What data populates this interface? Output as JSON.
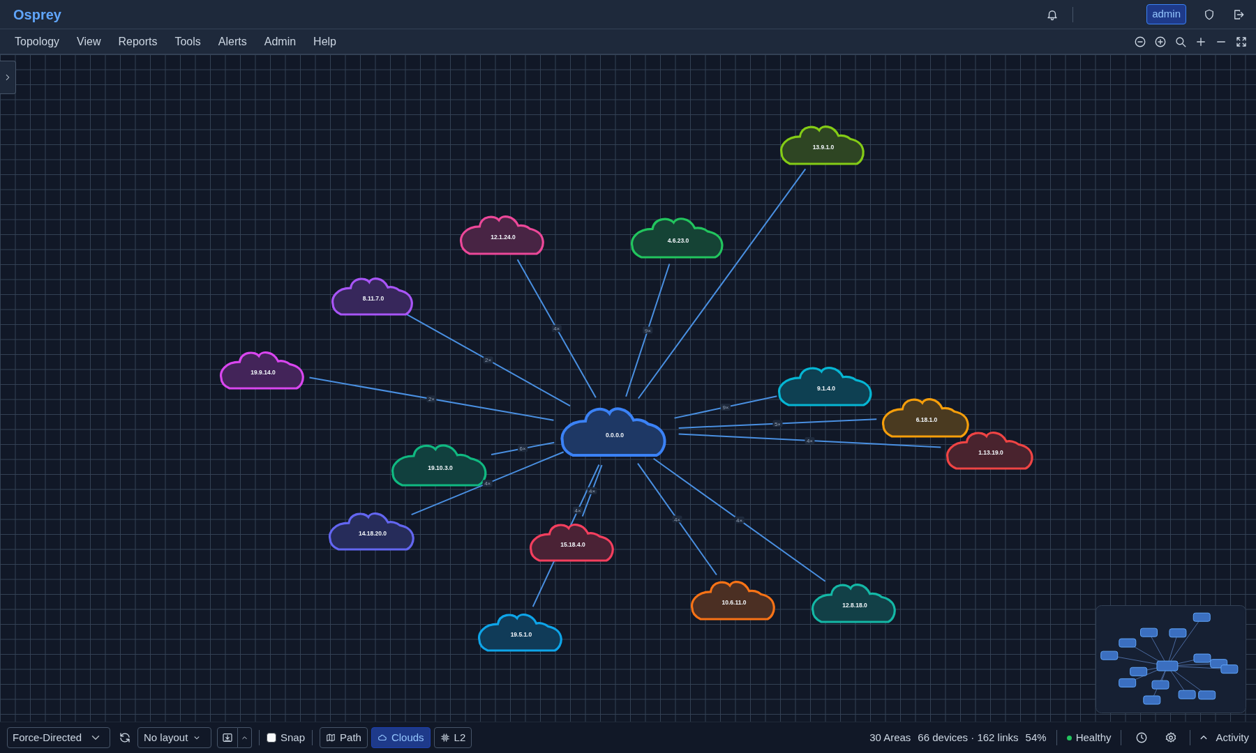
{
  "app": {
    "title": "Osprey"
  },
  "header": {
    "user": "admin"
  },
  "menu": [
    "Topology",
    "View",
    "Reports",
    "Tools",
    "Alerts",
    "Admin",
    "Help"
  ],
  "canvas": {
    "nodes": [
      {
        "label": "0.0.0.0",
        "kind": "hub",
        "color": "#3b82f6"
      },
      {
        "label": "13.9.1.0",
        "kind": "area",
        "color": "#84cc16"
      },
      {
        "label": "12.1.24.0",
        "kind": "area",
        "color": "#ec4899",
        "link_label": "4×"
      },
      {
        "label": "4.6.23.0",
        "kind": "area",
        "color": "#22c55e",
        "link_label": "9×"
      },
      {
        "label": "8.11.7.0",
        "kind": "area",
        "color": "#a855f7",
        "link_label": "2×"
      },
      {
        "label": "19.9.14.0",
        "kind": "area",
        "color": "#d946ef",
        "link_label": "2×"
      },
      {
        "label": "9.1.4.0",
        "kind": "area",
        "color": "#06b6d4",
        "link_label": "9×"
      },
      {
        "label": "6.18.1.0",
        "kind": "area",
        "color": "#f59e0b",
        "link_label": "5×"
      },
      {
        "label": "1.13.19.0",
        "kind": "area",
        "color": "#ef4444",
        "link_label": "4×"
      },
      {
        "label": "19.10.3.0",
        "kind": "area",
        "color": "#10b981",
        "link_label": "6×"
      },
      {
        "label": "14.18.20.0",
        "kind": "area",
        "color": "#6366f1",
        "link_label": "4×"
      },
      {
        "label": "15.18.4.0",
        "kind": "area",
        "color": "#f43f5e",
        "link_label": "4×"
      },
      {
        "label": "10.6.11.0",
        "kind": "area",
        "color": "#f97316",
        "link_label": "4×"
      },
      {
        "label": "12.8.18.0",
        "kind": "area",
        "color": "#14b8a6",
        "link_label": "4×"
      },
      {
        "label": "19.5.1.0",
        "kind": "area",
        "color": "#0ea5e9",
        "link_label": "4×"
      }
    ]
  },
  "toolbar": {
    "layout_algorithm": "Force-Directed",
    "layout_preset": "No layout",
    "snap": {
      "label": "Snap",
      "checked": false
    },
    "toggles": [
      {
        "label": "Path",
        "kind": "path",
        "selected": false
      },
      {
        "label": "Clouds",
        "kind": "clouds",
        "selected": true
      },
      {
        "label": "L2",
        "kind": "l2",
        "selected": false
      }
    ]
  },
  "status_bar": {
    "areas": "30 Areas",
    "summary": "66 devices · 162 links",
    "zoom": "54%",
    "health": {
      "label": "Healthy",
      "ok": true
    },
    "activity": "Activity"
  }
}
